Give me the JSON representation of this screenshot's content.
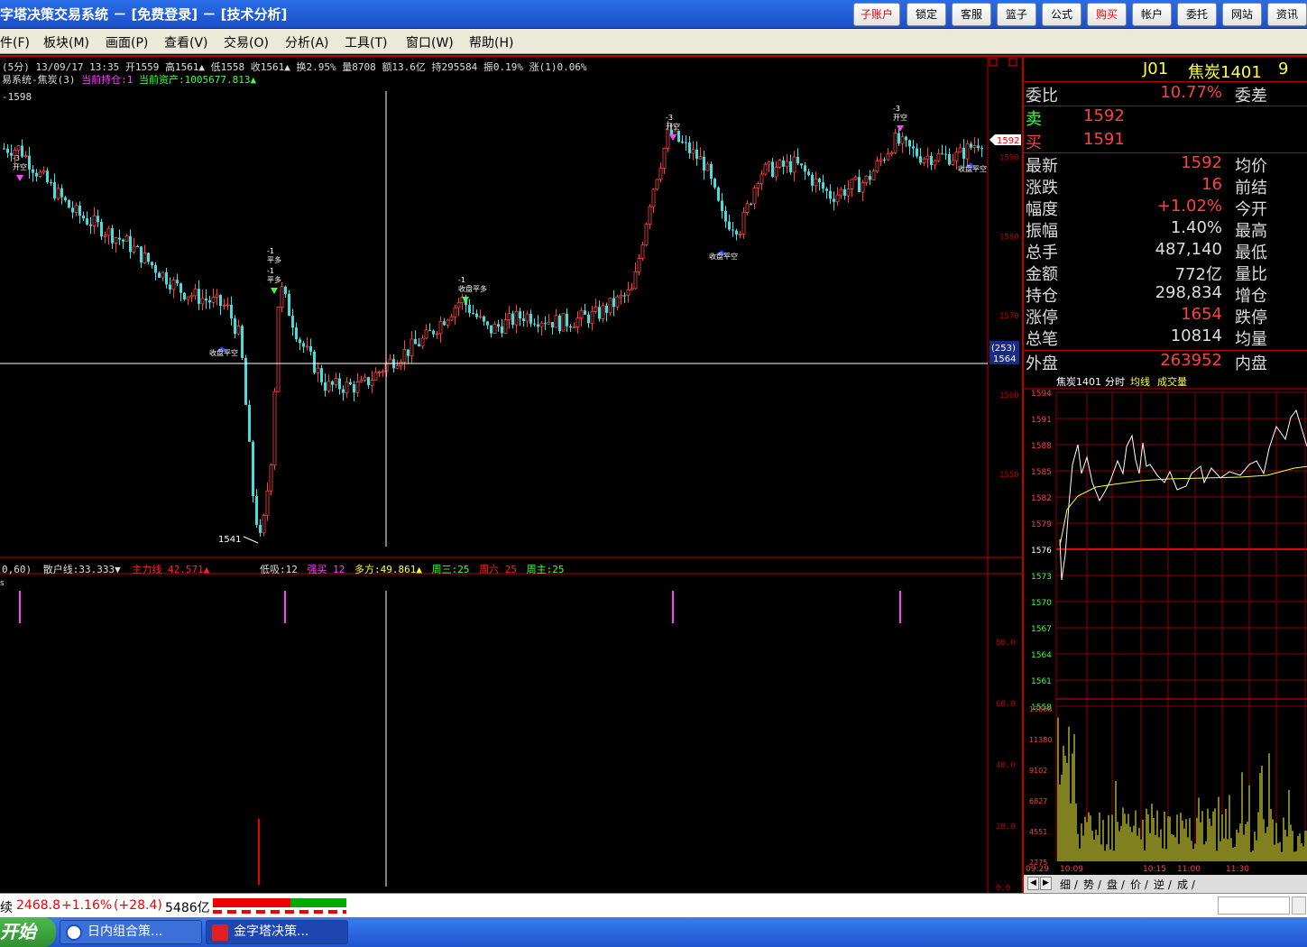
{
  "title": "字塔决策交易系统 － [免费登录] － [技术分析]",
  "toolbar": [
    {
      "label": "子账户",
      "red": true
    },
    {
      "label": "锁定",
      "red": false
    },
    {
      "label": "客服",
      "red": false
    },
    {
      "label": "篮子",
      "red": false
    },
    {
      "label": "公式",
      "red": false
    },
    {
      "label": "购买",
      "red": true
    },
    {
      "label": "帐户",
      "red": false
    },
    {
      "label": "委托",
      "red": false
    },
    {
      "label": "网站",
      "red": false
    },
    {
      "label": "资讯",
      "red": false
    }
  ],
  "menu": [
    "件(F)",
    "板块(M)",
    "画面(P)",
    "查看(V)",
    "交易(O)",
    "分析(A)",
    "工具(T)",
    "窗口(W)",
    "帮助(H)"
  ],
  "chart": {
    "header_line": "(5分) 13/09/17 13:35 开1559 高1561▲ 低1558 收1561▲ 换2.95% 量8708 额13.6亿 持295584 振0.19% 涨(1)0.06%",
    "system_name": "易系统-焦炭(3)",
    "position_label": "当前持仓:1",
    "assets_label": "当前资产:1005677.813▲",
    "ref_price": "1598",
    "low_marker": "1541",
    "price_axis": [
      "1590",
      "1580",
      "1570",
      "1560",
      "1550"
    ],
    "cursor_tag_top": "(253)",
    "cursor_tag_bottom": "1564",
    "last_price_tag": "1592",
    "signals": [
      {
        "line1": "-3",
        "line2": "开空"
      },
      {
        "line1": "-1",
        "line2": "平多"
      },
      {
        "line1": "-1",
        "line2": "平多"
      },
      {
        "line1": "-1",
        "line2": "收盘平多"
      },
      {
        "line1": "-3",
        "line2": "开空"
      },
      {
        "line1": "-3",
        "line2": "开空"
      }
    ],
    "close_labels": [
      "收盘平空",
      "收盘平空",
      "收盘平空"
    ],
    "indicator_line": {
      "prefix": "0,60)",
      "retail": "散户线:33.333▼",
      "main": "主力线 42.571▲",
      "low_buy": "低吸:12",
      "strong_buy": "强买 12",
      "bull": "多方:49.861▲",
      "wed": "周三:25",
      "fri": "周六 25",
      "week_main": "周主:25"
    },
    "indicator_axis": [
      "80.0",
      "60.0",
      "40.0",
      "20.0",
      "0.0"
    ]
  },
  "quote": {
    "code": "J01",
    "name": "焦炭1401",
    "extra": "9",
    "wei_bi_label": "委比",
    "wei_bi": "10.77%",
    "wei_cha_label": "委差",
    "sell_label": "卖",
    "sell": "1592",
    "buy_label": "买",
    "buy": "1591",
    "rows": [
      {
        "l": "最新",
        "v": "1592",
        "r": "均价",
        "c": "#ff4040"
      },
      {
        "l": "涨跌",
        "v": "16",
        "r": "前结",
        "c": "#ff4040"
      },
      {
        "l": "幅度",
        "v": "+1.02%",
        "r": "今开",
        "c": "#ff4040"
      },
      {
        "l": "振幅",
        "v": "1.40%",
        "r": "最高",
        "c": "#dddddd"
      },
      {
        "l": "总手",
        "v": "487,140",
        "r": "最低",
        "c": "#dddddd"
      },
      {
        "l": "金额",
        "v": "772亿",
        "r": "量比",
        "c": "#dddddd"
      },
      {
        "l": "持仓",
        "v": "298,834",
        "r": "增仓",
        "c": "#dddddd"
      },
      {
        "l": "涨停",
        "v": "1654",
        "r": "跌停",
        "c": "#ff4040"
      },
      {
        "l": "总笔",
        "v": "10814",
        "r": "均量",
        "c": "#dddddd"
      },
      {
        "l": "外盘",
        "v": "263952",
        "r": "内盘",
        "c": "#ff4040"
      }
    ]
  },
  "mini": {
    "header": "焦炭1401",
    "mode": "分时",
    "avg": "均线",
    "vol": "成交量",
    "price_ticks": [
      "1594",
      "1591",
      "1588",
      "1585",
      "1582",
      "1579",
      "1576",
      "1573",
      "1570",
      "1567",
      "1564",
      "1561",
      "1558"
    ],
    "vol_ticks": [
      "13868",
      "11380",
      "9102",
      "6827",
      "4551",
      "2275"
    ],
    "time_ticks": [
      "09:29",
      "10:09",
      "10:15",
      "11:00",
      "11:30"
    ],
    "tabs": [
      "细",
      "势",
      "盘",
      "价",
      "逆",
      "成"
    ]
  },
  "status": {
    "index_name": "续",
    "index_value": "2468.8",
    "index_change": "+1.16%",
    "index_delta": "(+28.4)",
    "turnover": "5486亿"
  },
  "taskbar": {
    "start": "开始",
    "items": [
      "日内组合策...",
      "金字塔决策..."
    ]
  },
  "colors": {
    "up": "#ff4040",
    "down": "#40e0e0",
    "grid": "#8b0000"
  }
}
